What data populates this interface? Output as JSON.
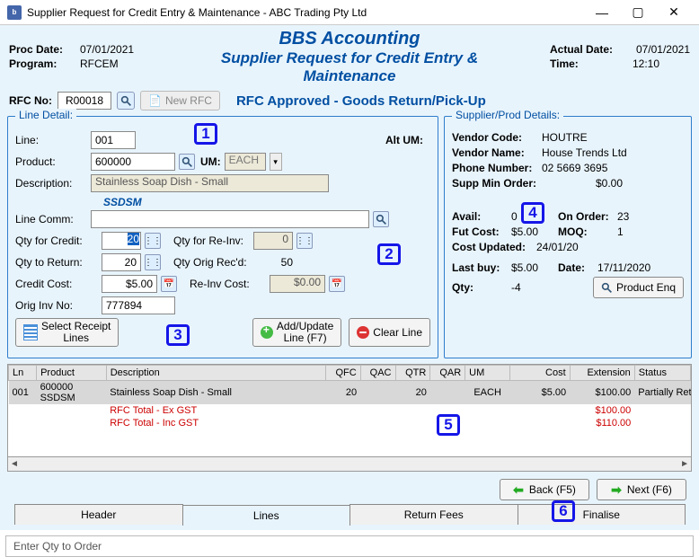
{
  "window": {
    "title": "Supplier Request for Credit Entry & Maintenance - ABC Trading Pty Ltd",
    "minimize": "—",
    "maximize": "▢",
    "close": "✕"
  },
  "header": {
    "proc_date_lbl": "Proc Date:",
    "proc_date": "07/01/2021",
    "program_lbl": "Program:",
    "program": "RFCEM",
    "title1": "BBS Accounting",
    "title2": "Supplier Request for Credit Entry & Maintenance",
    "actual_date_lbl": "Actual Date:",
    "actual_date": "07/01/2021",
    "time_lbl": "Time:",
    "time": "12:10"
  },
  "rfcbar": {
    "rfc_lbl": "RFC No:",
    "rfc_val": "R00018",
    "newrfc": "New RFC",
    "status": "RFC Approved - Goods Return/Pick-Up"
  },
  "line": {
    "legend": "Line Detail:",
    "line_lbl": "Line:",
    "line": "001",
    "product_lbl": "Product:",
    "product": "600000",
    "um_lbl": "UM:",
    "um": "EACH",
    "desc_lbl": "Description:",
    "desc": "Stainless Soap Dish - Small",
    "code": "SSDSM",
    "altum_lbl": "Alt UM:",
    "linecomm_lbl": "Line Comm:",
    "qfc_lbl": "Qty for Credit:",
    "qfc": "20",
    "qri_lbl": "Qty for Re-Inv:",
    "qri": "0",
    "qtr_lbl": "Qty to Return:",
    "qtr": "20",
    "qor_lbl": "Qty Orig Rec'd:",
    "qor": "50",
    "cc_lbl": "Credit Cost:",
    "cc": "$5.00",
    "ric_lbl": "Re-Inv Cost:",
    "ric": "$0.00",
    "oin_lbl": "Orig Inv No:",
    "oin": "777894",
    "btn_select": "Select Receipt\nLines",
    "btn_addupd": "Add/Update\nLine (F7)",
    "btn_clear": "Clear Line"
  },
  "supp": {
    "legend": "Supplier/Prod Details:",
    "vc_lbl": "Vendor Code:",
    "vc": "HOUTRE",
    "vn_lbl": "Vendor Name:",
    "vn": "House Trends Ltd",
    "ph_lbl": "Phone Number:",
    "ph": "02 5669 3695",
    "smo_lbl": "Supp Min Order:",
    "smo": "$0.00",
    "avail_lbl": "Avail:",
    "avail": "0",
    "onord_lbl": "On Order:",
    "onord": "23",
    "fut_lbl": "Fut Cost:",
    "fut": "$5.00",
    "moq_lbl": "MOQ:",
    "moq": "1",
    "cu_lbl": "Cost Updated:",
    "cu": "24/01/20",
    "lb_lbl": "Last buy:",
    "lb": "$5.00",
    "dt_lbl": "Date:",
    "dt": "17/11/2020",
    "qty_lbl": "Qty:",
    "qty": "-4",
    "btn_enq": "Product Enq"
  },
  "table": {
    "cols": [
      "Ln",
      "Product",
      "Description",
      "QFC",
      "QAC",
      "QTR",
      "QAR",
      "UM",
      "Cost",
      "Extension",
      "Status"
    ],
    "rows": [
      {
        "ln": "001",
        "product": "600000 SSDSM",
        "desc": "Stainless Soap Dish - Small",
        "qfc": "20",
        "qac": "",
        "qtr": "20",
        "qar": "",
        "um": "EACH",
        "cost": "$5.00",
        "ext": "$100.00",
        "status": "Partially Returne"
      }
    ],
    "totals": [
      {
        "label": "RFC Total - Ex GST",
        "value": "$100.00"
      },
      {
        "label": "RFC Total - Inc GST",
        "value": "$110.00"
      }
    ]
  },
  "nav": {
    "back": "Back (F5)",
    "next": "Next (F6)"
  },
  "tabs": [
    "Header",
    "Lines",
    "Return Fees",
    "Finalise"
  ],
  "statusbar": "Enter Qty to Order",
  "badges": [
    "1",
    "2",
    "3",
    "4",
    "5",
    "6"
  ]
}
